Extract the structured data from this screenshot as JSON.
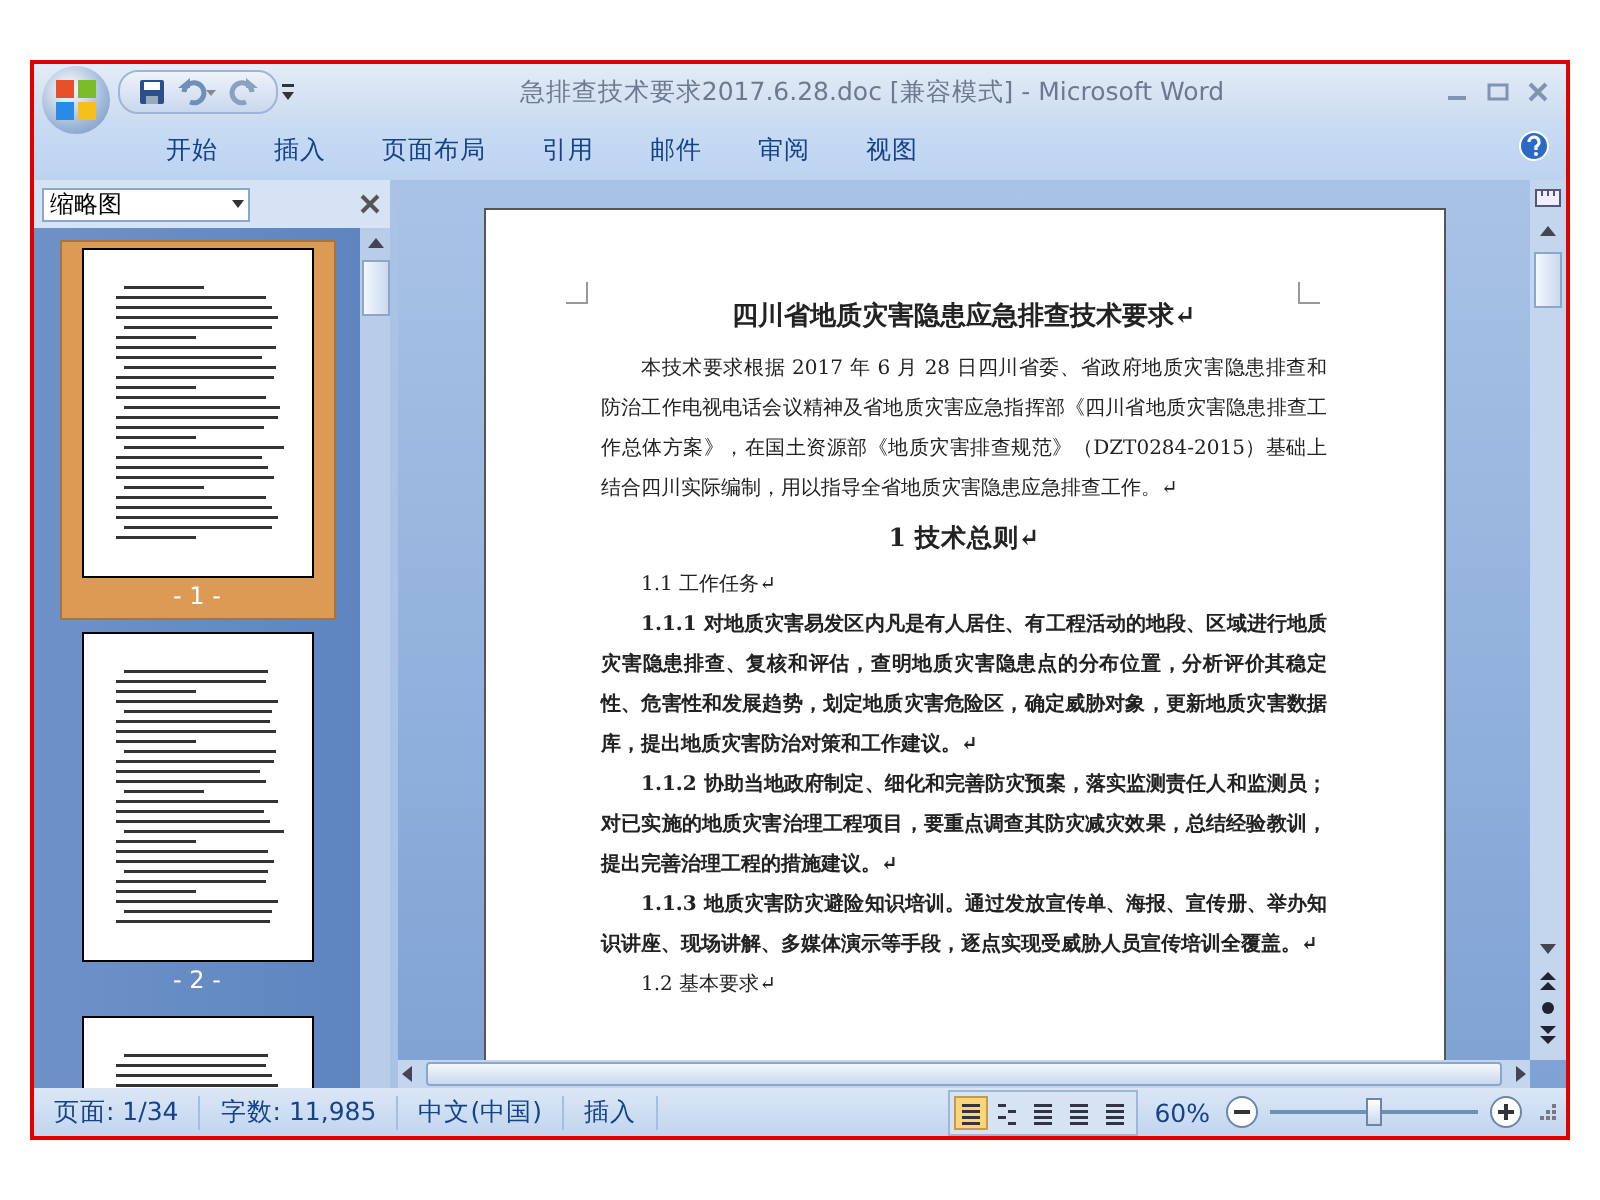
{
  "window": {
    "title": "急排查技术要求2017.6.28.doc [兼容模式] - Microsoft Word"
  },
  "ribbon_tabs": [
    {
      "label": "开始"
    },
    {
      "label": "插入"
    },
    {
      "label": "页面布局"
    },
    {
      "label": "引用"
    },
    {
      "label": "邮件"
    },
    {
      "label": "审阅"
    },
    {
      "label": "视图"
    }
  ],
  "thumbnail_pane": {
    "title": "缩略图",
    "thumbnails": [
      {
        "label": "- 1 -",
        "selected": true
      },
      {
        "label": "- 2 -",
        "selected": false
      },
      {
        "selected": false
      }
    ]
  },
  "document": {
    "paragraphs": [
      {
        "kind": "title",
        "text": "四川省地质灾害隐患应急排查技术要求↵"
      },
      {
        "kind": "body",
        "text": "本技术要求根据 2017 年 6 月 28 日四川省委、省政府地质灾害隐患排查和防治工作电视电话会议精神及省地质灾害应急指挥部《四川省地质灾害隐患排查工作总体方案》，在国土资源部《地质灾害排查规范》（DZT0284-2015）基础上结合四川实际编制，用以指导全省地质灾害隐患应急排查工作。↵"
      },
      {
        "kind": "heading",
        "text": "1  技术总则↵"
      },
      {
        "kind": "body",
        "text": "1.1 工作任务↵"
      },
      {
        "kind": "bold",
        "text": "1.1.1 对地质灾害易发区内凡是有人居住、有工程活动的地段、区域进行地质灾害隐患排查、复核和评估，查明地质灾害隐患点的分布位置，分析评价其稳定性、危害性和发展趋势，划定地质灾害危险区，确定威胁对象，更新地质灾害数据库，提出地质灾害防治对策和工作建议。↵"
      },
      {
        "kind": "bold",
        "text": "1.1.2 协助当地政府制定、细化和完善防灾预案，落实监测责任人和监测员；对已实施的地质灾害治理工程项目，要重点调查其防灾减灾效果，总结经验教训，提出完善治理工程的措施建议。↵"
      },
      {
        "kind": "bold",
        "text": "1.1.3 地质灾害防灾避险知识培训。通过发放宣传单、海报、宣传册、举办知识讲座、现场讲解、多媒体演示等手段，逐点实现受威胁人员宣传培训全覆盖。↵"
      },
      {
        "kind": "body",
        "text": "1.2 基本要求↵"
      }
    ]
  },
  "status_bar": {
    "page": "页面: 1/34",
    "words": "字数: 11,985",
    "language": "中文(中国)",
    "mode": "插入",
    "views": [
      {
        "selected": true
      },
      {
        "selected": false
      },
      {
        "selected": false
      },
      {
        "selected": false
      },
      {
        "selected": false
      }
    ],
    "zoom": "60%",
    "zoom_level": {
      "level": 0.5
    }
  }
}
